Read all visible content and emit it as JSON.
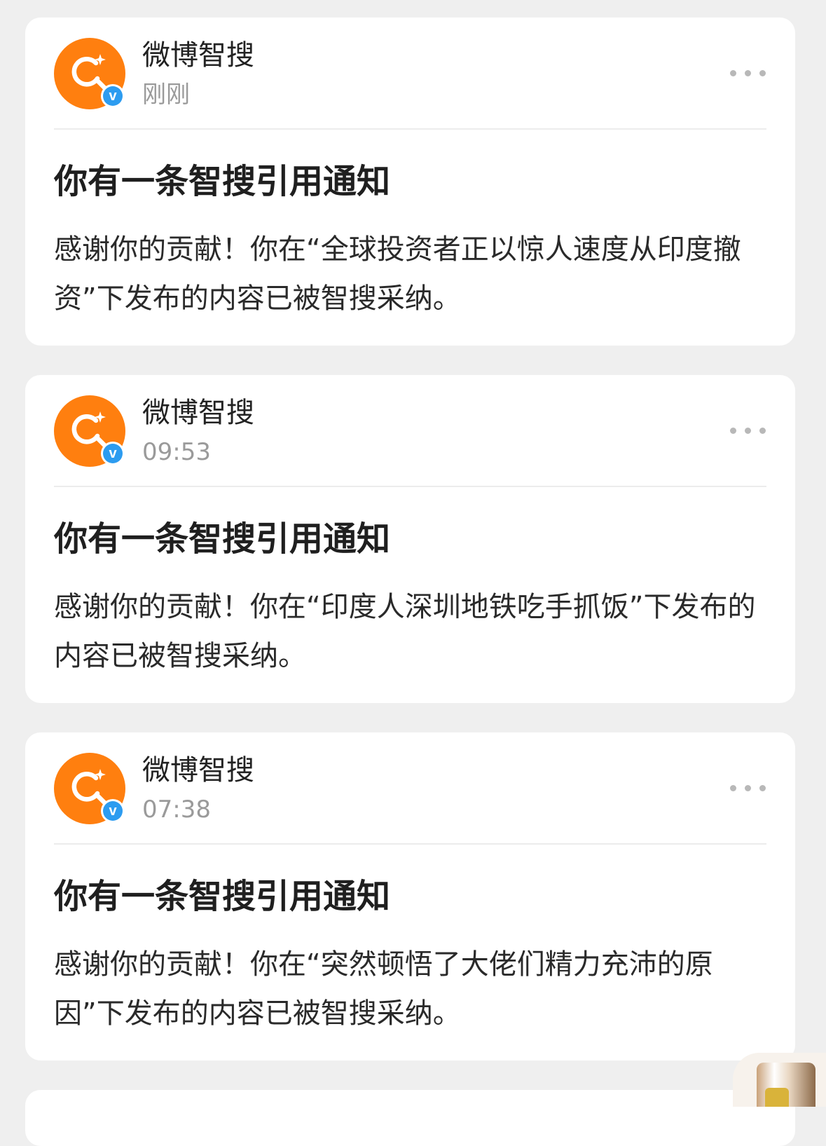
{
  "feed": {
    "cards": [
      {
        "account_name": "微博智搜",
        "time": "刚刚",
        "title": "你有一条智搜引用通知",
        "body": "感谢你的贡献！你在“全球投资者正以惊人速度从印度撤资”下发布的内容已被智搜采纳。"
      },
      {
        "account_name": "微博智搜",
        "time": "09:53",
        "title": "你有一条智搜引用通知",
        "body": "感谢你的贡献！你在“印度人深圳地铁吃手抓饭”下发布的内容已被智搜采纳。"
      },
      {
        "account_name": "微博智搜",
        "time": "07:38",
        "title": "你有一条智搜引用通知",
        "body": "感谢你的贡献！你在“突然顿悟了大佬们精力充沛的原因”下发布的内容已被智搜采纳。"
      }
    ]
  },
  "icons": {
    "avatar": "weibo-search-logo-icon",
    "verified": "verified-badge-icon",
    "more": "more-options-icon"
  },
  "colors": {
    "brand_orange": "#ff7f0f",
    "verified_blue": "#2d9cf0",
    "background": "#efefef",
    "card": "#ffffff"
  }
}
